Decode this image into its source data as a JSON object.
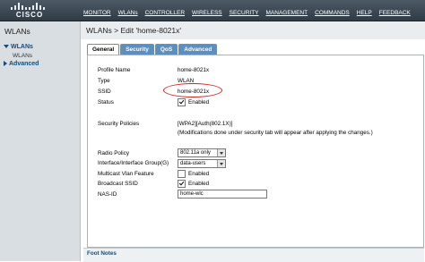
{
  "brand": {
    "logo_text": "CISCO"
  },
  "nav": [
    {
      "label": "MONITOR"
    },
    {
      "label": "WLANs"
    },
    {
      "label": "CONTROLLER"
    },
    {
      "label": "WIRELESS"
    },
    {
      "label": "SECURITY"
    },
    {
      "label": "MANAGEMENT"
    },
    {
      "label": "COMMANDS"
    },
    {
      "label": "HELP"
    },
    {
      "label": "FEEDBACK"
    }
  ],
  "sidebar": {
    "title": "WLANs",
    "items": [
      {
        "label": "WLANs",
        "sub": "WLANs"
      },
      {
        "label": "Advanced"
      }
    ]
  },
  "page": {
    "title": "WLANs > Edit  'home-8021x'"
  },
  "tabs": [
    {
      "label": "General",
      "active": true
    },
    {
      "label": "Security"
    },
    {
      "label": "QoS"
    },
    {
      "label": "Advanced"
    }
  ],
  "form": {
    "profile_name": {
      "label": "Profile Name",
      "value": "home-8021x"
    },
    "type": {
      "label": "Type",
      "value": "WLAN"
    },
    "ssid": {
      "label": "SSID",
      "value": "home-8021x"
    },
    "status": {
      "label": "Status",
      "value": "Enabled",
      "checked": true
    },
    "security_policies": {
      "label": "Security Policies",
      "value": "[WPA2][Auth(802.1X)]",
      "note": "(Modifications done under security tab will appear after applying the changes.)"
    },
    "radio_policy": {
      "label": "Radio Policy",
      "value": "802.11a only"
    },
    "interface_group": {
      "label": "Interface/Interface Group(G)",
      "value": "data-users"
    },
    "multicast_vlan": {
      "label": "Multicast Vlan Feature",
      "value": "Enabled",
      "checked": false
    },
    "broadcast_ssid": {
      "label": "Broadcast SSID",
      "value": "Enabled",
      "checked": true
    },
    "nas_id": {
      "label": "NAS-ID",
      "value": "home-wlc"
    }
  },
  "footer": {
    "title": "Foot Notes"
  },
  "colors": {
    "topbar": "#3a4752",
    "tab_inactive": "#5a8fc0",
    "annotation": "#d42020",
    "link": "#124c7a"
  }
}
